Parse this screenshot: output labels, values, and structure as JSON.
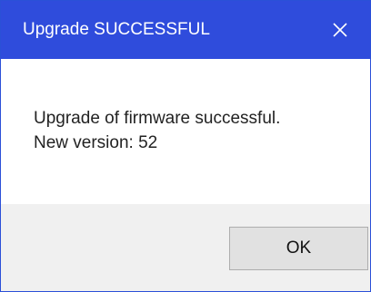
{
  "dialog": {
    "title": "Upgrade SUCCESSFUL",
    "close_icon": "close-icon",
    "message_line1": "Upgrade of firmware successful.",
    "message_line2": "New version: 52",
    "ok_label": "OK"
  },
  "colors": {
    "titlebar": "#2f4cdc",
    "border": "#2b50d8",
    "footer": "#f0f0f0",
    "button": "#e1e1e1"
  }
}
